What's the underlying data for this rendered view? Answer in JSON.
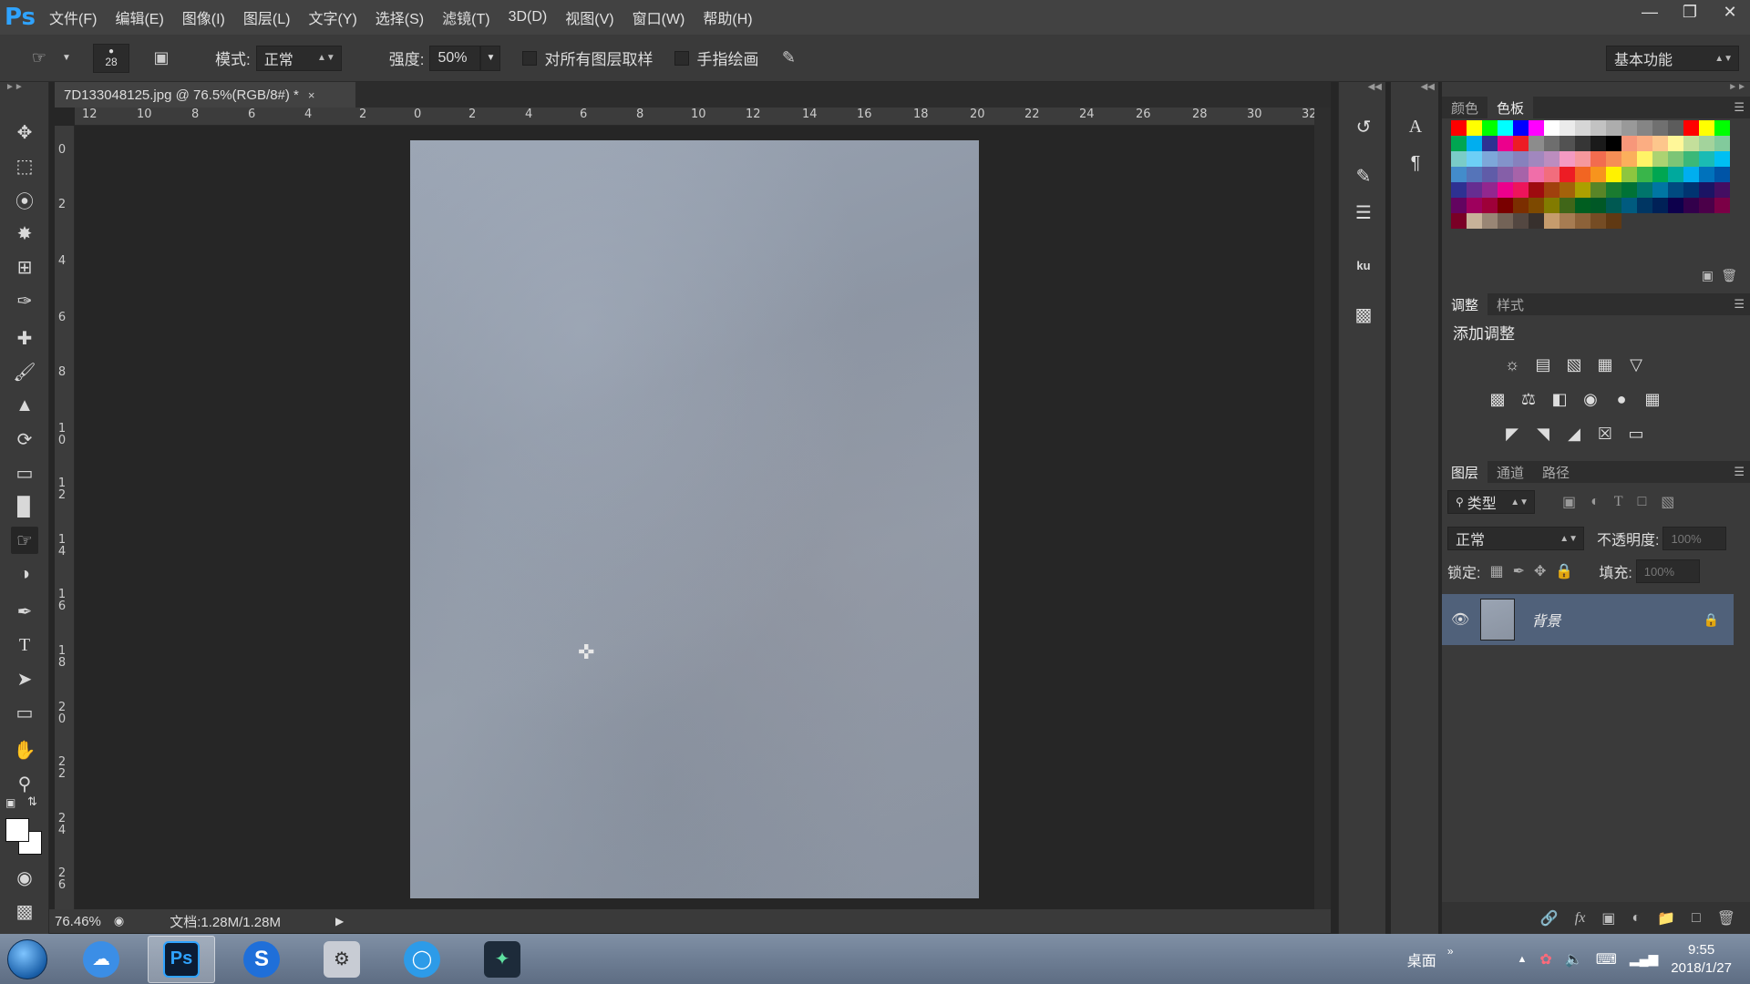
{
  "app": {
    "logo": "Ps"
  },
  "menu": [
    "文件(F)",
    "编辑(E)",
    "图像(I)",
    "图层(L)",
    "文字(Y)",
    "选择(S)",
    "滤镜(T)",
    "3D(D)",
    "视图(V)",
    "窗口(W)",
    "帮助(H)"
  ],
  "options": {
    "brush_size": "28",
    "mode_label": "模式:",
    "mode_value": "正常",
    "strength_label": "强度:",
    "strength_value": "50%",
    "sample_all_label": "对所有图层取样",
    "finger_paint_label": "手指绘画",
    "workspace": "基本功能"
  },
  "document": {
    "tab_title": "7D133048125.jpg @ 76.5%(RGB/8#) *",
    "close_glyph": "×"
  },
  "rulers": {
    "top": [
      "12",
      "10",
      "8",
      "6",
      "4",
      "2",
      "0",
      "2",
      "4",
      "6",
      "8",
      "10",
      "12",
      "14",
      "16",
      "18",
      "20",
      "22",
      "24",
      "26",
      "28",
      "30",
      "32"
    ],
    "left": [
      "0",
      "2",
      "4",
      "6",
      "8",
      "10",
      "12",
      "14",
      "16",
      "18",
      "20",
      "22",
      "24",
      "26"
    ]
  },
  "status": {
    "zoom": "76.46%",
    "doc_size": "文档:1.28M/1.28M"
  },
  "panels": {
    "color_tabs": [
      "颜色",
      "色板"
    ],
    "adjust_tabs": [
      "调整",
      "样式"
    ],
    "adjust_title": "添加调整",
    "layers_tabs": [
      "图层",
      "通道",
      "路径"
    ],
    "layer_filter": "类型",
    "blend_mode": "正常",
    "opacity_label": "不透明度:",
    "opacity_value": "100%",
    "lock_label": "锁定:",
    "fill_label": "填充:",
    "fill_value": "100%",
    "layer_name": "背景"
  },
  "swatch_colors": [
    "#ff0000",
    "#ffff00",
    "#00ff00",
    "#00ffff",
    "#0000ff",
    "#ff00ff",
    "#ffffff",
    "#ebebeb",
    "#d6d6d6",
    "#c2c2c2",
    "#adadad",
    "#999999",
    "#858585",
    "#707070",
    "#5c5c5c",
    "#ff0000",
    "#ffff00",
    "#00ff00",
    "#00a651",
    "#00aeef",
    "#2e3192",
    "#ec008c",
    "#ed1c24",
    "#8c8c8c",
    "#6e6e6e",
    "#525252",
    "#363636",
    "#1a1a1a",
    "#000000",
    "#f7977a",
    "#fbad82",
    "#fdc68c",
    "#fff799",
    "#c4df9b",
    "#a3d39c",
    "#82ca9c",
    "#7accc8",
    "#6dcff6",
    "#7da7d9",
    "#8393ca",
    "#8781bd",
    "#a187be",
    "#bc8dbf",
    "#f49ac2",
    "#f6989d",
    "#f26c4f",
    "#f68e55",
    "#fbaf5c",
    "#fff467",
    "#acd372",
    "#7cc576",
    "#3bb878",
    "#1abbb4",
    "#00bff3",
    "#438ccb",
    "#5574b9",
    "#605ca8",
    "#855fa8",
    "#a763a9",
    "#f06ea9",
    "#f26d7d",
    "#ed1c24",
    "#f26522",
    "#f7941d",
    "#fff200",
    "#8dc63f",
    "#39b54a",
    "#00a651",
    "#00a99d",
    "#00aeef",
    "#0072bc",
    "#0054a6",
    "#2e3192",
    "#662d91",
    "#92278f",
    "#ec008c",
    "#ed145b",
    "#9e0b0f",
    "#a0410d",
    "#a3620a",
    "#aba000",
    "#598527",
    "#1a7b30",
    "#007236",
    "#00746b",
    "#0076a3",
    "#004a80",
    "#003471",
    "#1b1464",
    "#440e62",
    "#630460",
    "#9e005d",
    "#9e0039",
    "#790000",
    "#7b2e00",
    "#7d4900",
    "#827b00",
    "#406618",
    "#005e20",
    "#005826",
    "#005952",
    "#005b7f",
    "#003663",
    "#002157",
    "#0d004c",
    "#32004b",
    "#4b0049",
    "#7b0046",
    "#7a0026",
    "#c7b299",
    "#998675",
    "#736357",
    "#534741",
    "#37302d",
    "#c69c6d",
    "#a67c52",
    "#8c6239",
    "#754c24",
    "#603913"
  ],
  "taskbar": {
    "desktop_label": "桌面",
    "time": "9:55",
    "date": "2018/1/27"
  },
  "colors": {
    "ps_blue": "#2fa3ff",
    "selected_layer": "#50617a"
  }
}
